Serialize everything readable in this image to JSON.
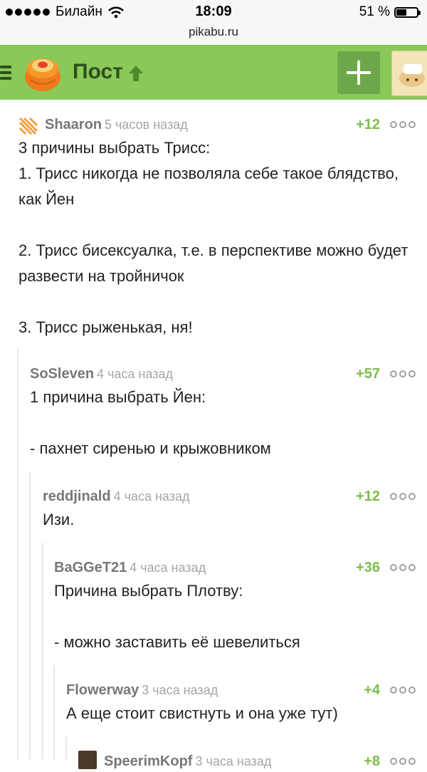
{
  "status_bar": {
    "carrier": "Билайн",
    "time": "18:09",
    "battery": "51 %",
    "battery_level": 0.51
  },
  "url": "pikabu.ru",
  "header": {
    "title": "Пост"
  },
  "comments": [
    {
      "user": "Shaaron",
      "time": "5 часов назад",
      "rating": "+12",
      "text": "3 причины выбрать Трисс:\n1. Трисс никогда не позволяла себе такое блядство, как Йен\n\n2. Трисс бисексуалка, т.е. в перспективе можно будет развести на тройничок\n\n3. Трисс рыженькая, ня!"
    },
    {
      "user": "SoSleven",
      "time": "4 часа назад",
      "rating": "+57",
      "text": "1 причина выбрать Йен:\n\n- пахнет сиренью и крыжовником"
    },
    {
      "user": "reddjinald",
      "time": "4 часа назад",
      "rating": "+12",
      "text": "Изи."
    },
    {
      "user": "BaGGeT21",
      "time": "4 часа назад",
      "rating": "+36",
      "text": "Причина выбрать Плотву:\n\n- можно заставить её шевелиться"
    },
    {
      "user": "Flowerway",
      "time": "3 часа назад",
      "rating": "+4",
      "text": "А еще стоит свистнуть и она уже тут)"
    },
    {
      "user": "SpeerimKopf",
      "time": "3 часа назад",
      "rating": "+8",
      "text": ""
    }
  ]
}
